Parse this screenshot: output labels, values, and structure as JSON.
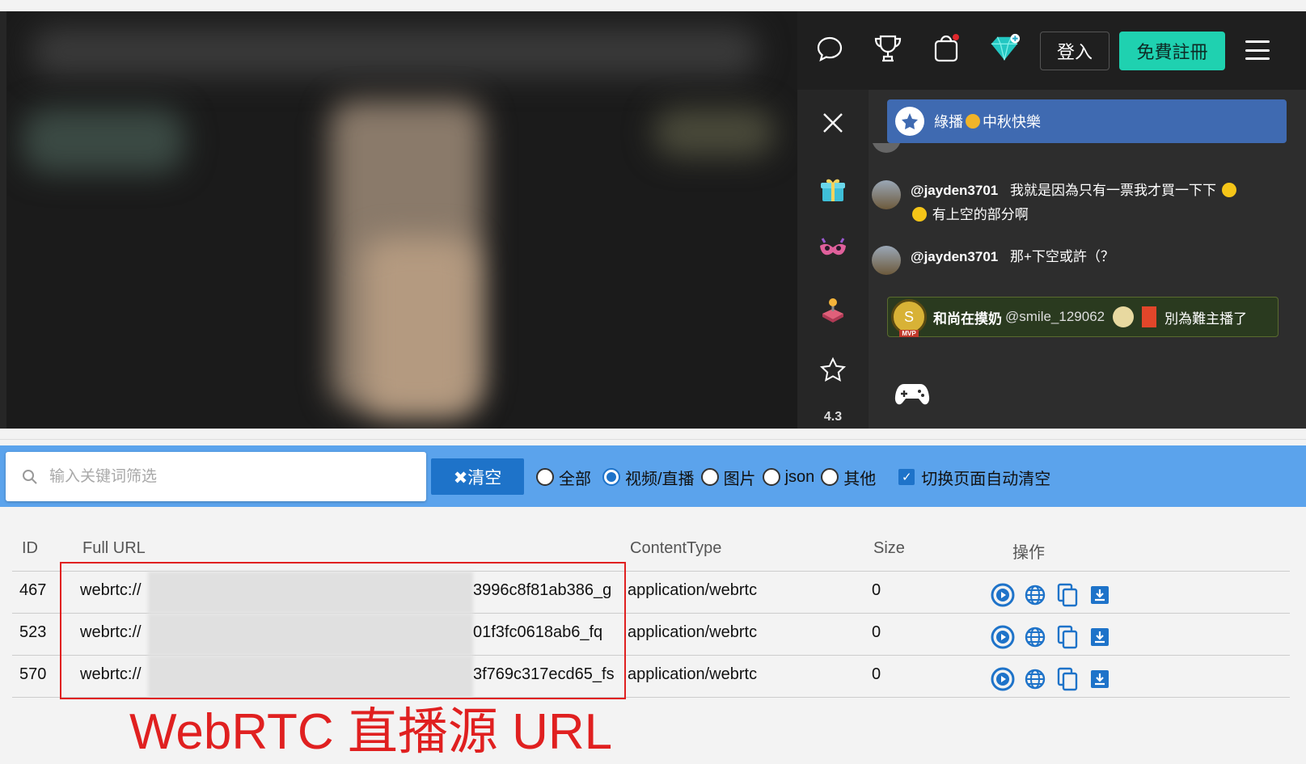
{
  "header": {
    "login_label": "登入",
    "register_label": "免費註冊"
  },
  "side_rail": {
    "rating": "4.3"
  },
  "chat": {
    "pinned": {
      "prefix": "綠播",
      "suffix": "中秋快樂"
    },
    "messages": [
      {
        "user": "@jayden3701",
        "text_line1": "我就是因為只有一票我才買一下下",
        "text_line2": "有上空的部分啊"
      },
      {
        "user": "@jayden3701",
        "text_line1": "那+下空或許（？"
      }
    ],
    "mvp_message": {
      "badge_letter": "S",
      "nickname": "和尚在摸奶",
      "handle": "@smile_129062",
      "text": "別為難主播了"
    }
  },
  "sniffer": {
    "search_placeholder": "输入关键词筛选",
    "clear_label": "✖清空",
    "filters": [
      {
        "label": "全部",
        "checked": false
      },
      {
        "label": "视频/直播",
        "checked": true
      },
      {
        "label": "图片",
        "checked": false
      },
      {
        "label": "json",
        "checked": false
      },
      {
        "label": "其他",
        "checked": false
      }
    ],
    "auto_clear_label": "切换页面自动清空",
    "columns": {
      "id": "ID",
      "url": "Full URL",
      "content_type": "ContentType",
      "size": "Size",
      "actions": "操作"
    },
    "rows": [
      {
        "id": "467",
        "url_prefix": "webrtc://",
        "url_suffix": "3996c8f81ab386_g",
        "content_type": "application/webrtc",
        "size": "0"
      },
      {
        "id": "523",
        "url_prefix": "webrtc://",
        "url_suffix": "01f3fc0618ab6_fq",
        "content_type": "application/webrtc",
        "size": "0"
      },
      {
        "id": "570",
        "url_prefix": "webrtc://",
        "url_suffix": "3f769c317ecd65_fs",
        "content_type": "application/webrtc",
        "size": "0"
      }
    ]
  },
  "annotation": {
    "caption": "WebRTC 直播源 URL",
    "color": "#e02020"
  },
  "colors": {
    "toolbar": "#5ba3ec",
    "accent_blue": "#1e73c9",
    "register_green": "#1fd1b0"
  }
}
